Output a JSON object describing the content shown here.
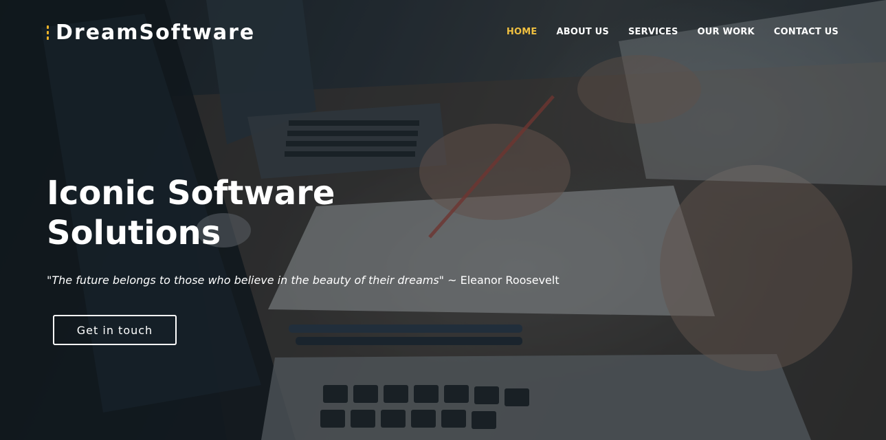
{
  "brand": {
    "name": "DreamSoftware",
    "accent_color": "#f0b429"
  },
  "nav": {
    "items": [
      {
        "label": "HOME",
        "active": true
      },
      {
        "label": "ABOUT US",
        "active": false
      },
      {
        "label": "SERVICES",
        "active": false
      },
      {
        "label": "OUR WORK",
        "active": false
      },
      {
        "label": "CONTACT US",
        "active": false
      }
    ],
    "active_color": "#f0c040"
  },
  "hero": {
    "headline": "Iconic Software Solutions",
    "quote_text": "\"The future belongs to those who believe in the beauty of their dreams\"",
    "quote_author": "~ Eleanor Roosevelt",
    "cta_label": "Get in touch"
  }
}
